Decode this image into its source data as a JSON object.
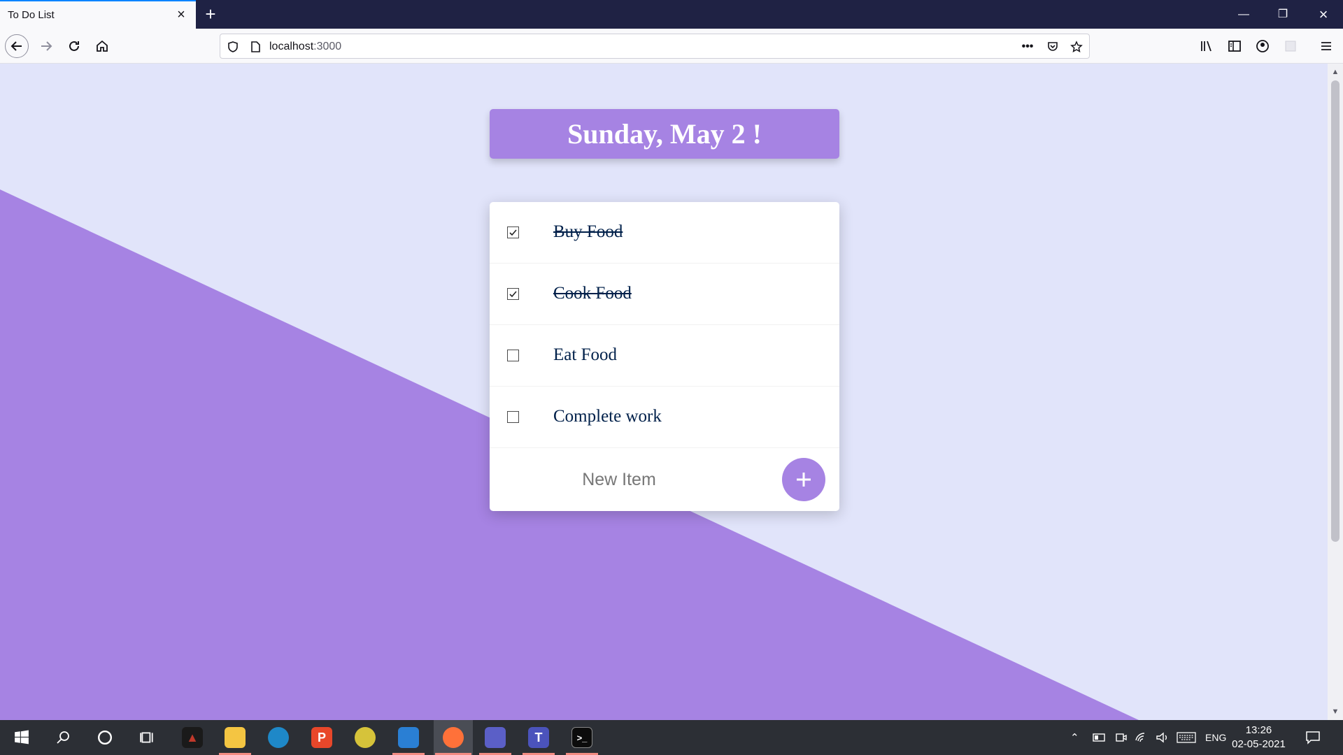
{
  "browser": {
    "tab_title": "To Do List",
    "url_host": "localhost",
    "url_port": ":3000"
  },
  "page": {
    "heading": "Sunday, May 2 !",
    "items": [
      {
        "label": "Buy Food",
        "checked": true
      },
      {
        "label": "Cook Food",
        "checked": true
      },
      {
        "label": "Eat Food",
        "checked": false
      },
      {
        "label": "Complete work",
        "checked": false
      }
    ],
    "new_item_placeholder": "New Item",
    "accent_color": "#a683e3",
    "background_color": "#e1e4fa",
    "text_color": "#00204a"
  },
  "taskbar": {
    "language": "ENG",
    "time": "13:26",
    "date": "02-05-2021"
  }
}
